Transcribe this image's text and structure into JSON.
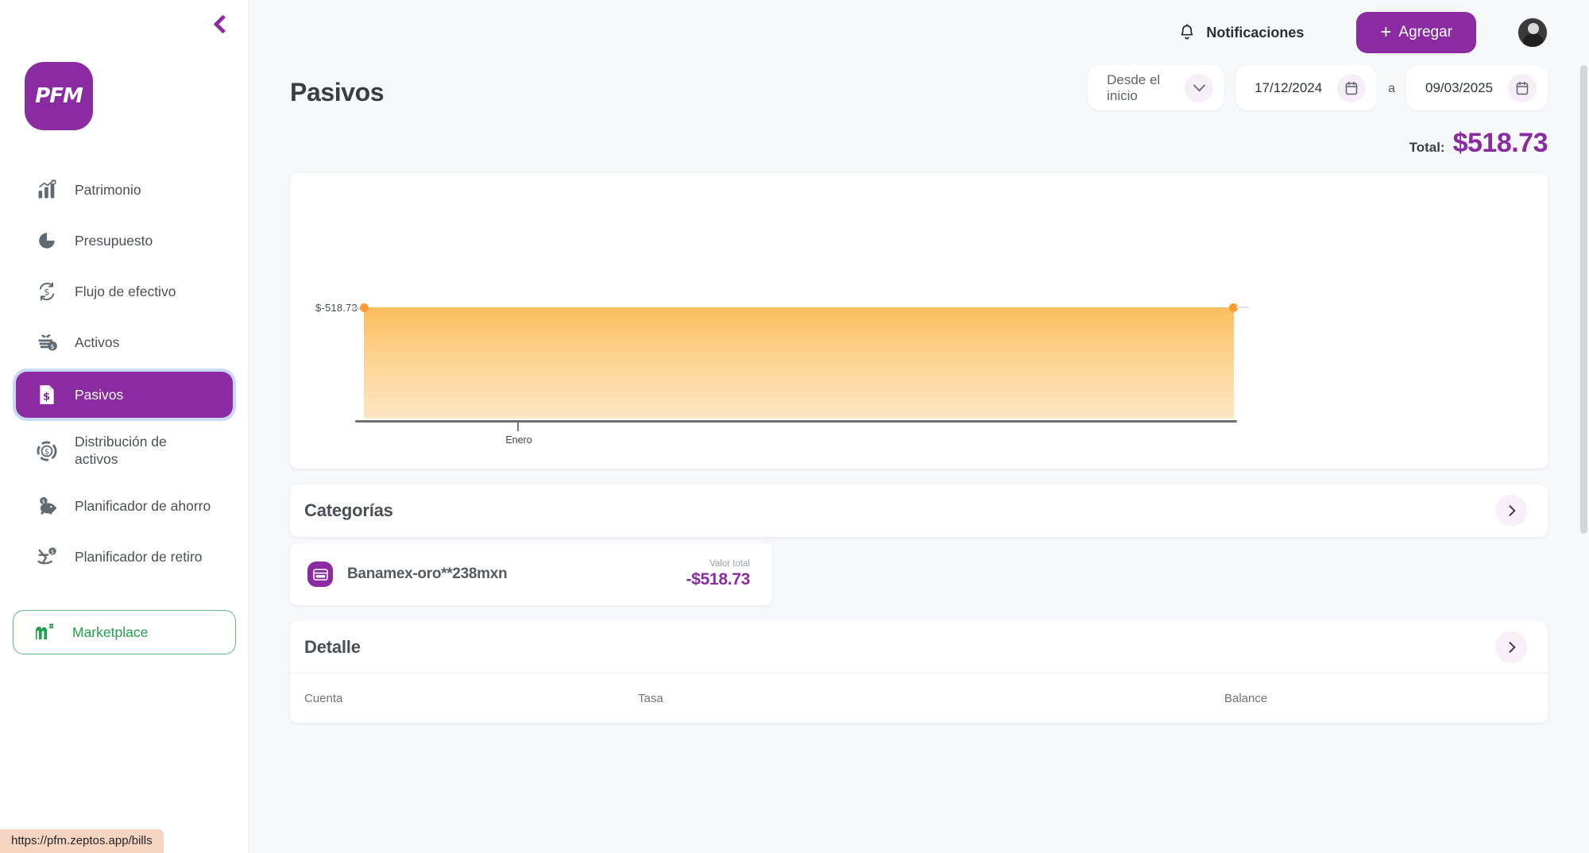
{
  "brand": {
    "logo_text": "PFM",
    "accent": "#8a2ba2",
    "green": "#21a04c"
  },
  "sidebar": {
    "collapse_label": "Colapsar menú",
    "items": [
      {
        "label": "Patrimonio",
        "icon": "bar-chart-icon",
        "active": false
      },
      {
        "label": "Presupuesto",
        "icon": "pie-chart-icon",
        "active": false
      },
      {
        "label": "Flujo de efectivo",
        "icon": "cash-flow-icon",
        "active": false
      },
      {
        "label": "Activos",
        "icon": "assets-icon",
        "active": false
      },
      {
        "label": "Pasivos",
        "icon": "liabilities-icon",
        "active": true
      },
      {
        "label": "Distribución de\nactivos",
        "icon": "asset-allocation-icon",
        "active": false
      },
      {
        "label": "Planificador de ahorro",
        "icon": "piggy-bank-icon",
        "active": false
      },
      {
        "label": "Planificador de retiro",
        "icon": "rocking-chair-icon",
        "active": false
      }
    ],
    "marketplace": {
      "label": "Marketplace",
      "icon": "marketplace-icon"
    }
  },
  "topbar": {
    "notifications_label": "Notificaciones",
    "add_label": "Agregar",
    "add_plus": "+"
  },
  "header": {
    "page_title": "Pasivos",
    "range_select_value": "Desde el inicio",
    "date_from": "17/12/2024",
    "date_separator": "a",
    "date_to": "09/03/2025",
    "total_label": "Total:",
    "total_value": "$518.73"
  },
  "chart_data": {
    "type": "area",
    "title": "",
    "xlabel": "",
    "ylabel": "",
    "x": [
      "Enero"
    ],
    "categories": [
      "Enero"
    ],
    "tick_labels_x": [
      "Enero"
    ],
    "tick_labels_y": [
      "$-518.73"
    ],
    "values": [
      -518.73,
      -518.73
    ],
    "series": [
      {
        "name": "Pasivos",
        "values": [
          -518.73,
          -518.73
        ]
      }
    ],
    "ylim": [
      -518.73,
      0
    ],
    "grid": false,
    "legend": "none",
    "point_color": "#fb9a32",
    "fill_top_color": "#fbbe5e",
    "fill_bottom_color": "#fde6c4"
  },
  "categories_section": {
    "title": "Categorías",
    "arrow_icon": "chevron-right-icon",
    "cards": [
      {
        "icon": "credit-card-icon",
        "name": "Banamex-oro**238mxn",
        "sub_label": "Valor total",
        "amount": "-$518.73"
      }
    ]
  },
  "detail_section": {
    "title": "Detalle",
    "arrow_icon": "chevron-right-icon",
    "columns": [
      "Cuenta",
      "Tasa",
      "Balance"
    ],
    "rows": []
  },
  "statusbar": {
    "url": "https://pfm.zeptos.app/bills"
  }
}
